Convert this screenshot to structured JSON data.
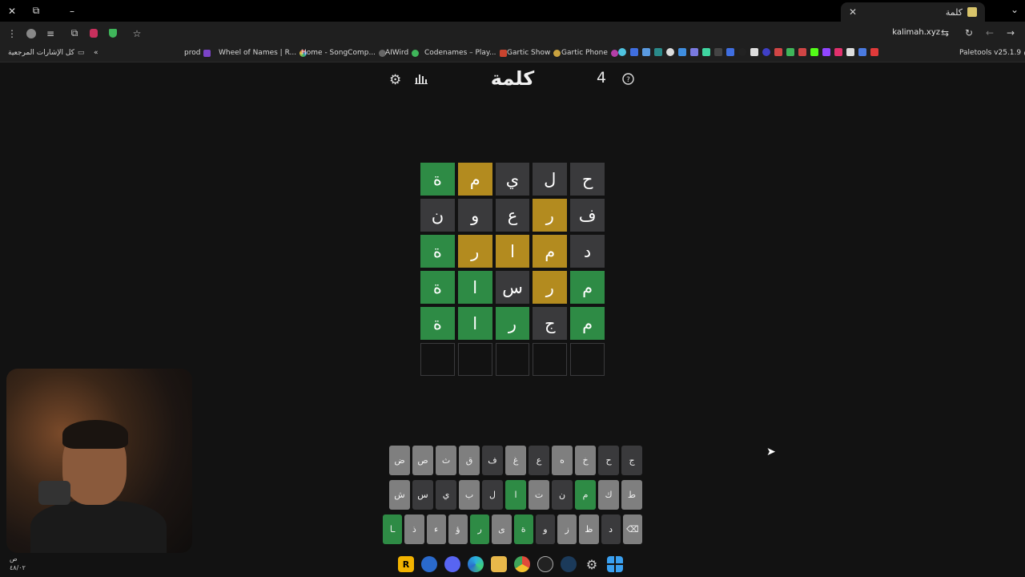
{
  "browser": {
    "tab_title": "كلمة",
    "url": "kalimah.xyz",
    "bookmarks_label": "كل الإشارات المرجعية",
    "bookmarks": [
      {
        "label": "prod",
        "color": "#7a43c6"
      },
      {
        "label": "Wheel of Names | R...",
        "color": "#e0473c"
      },
      {
        "label": "Home - SongComp...",
        "color": "#666666"
      },
      {
        "label": "AIWird",
        "color": "#3fb55a"
      },
      {
        "label": "Codenames – Play...",
        "color": "#c9442f"
      },
      {
        "label": "Gartic Show",
        "color": "#c9a23f"
      },
      {
        "label": "Gartic Phone",
        "color": "#b43fa8"
      }
    ],
    "extension_label": "Paletools v25.1.9"
  },
  "game": {
    "title": "كلمة",
    "streak": "4",
    "settings_icon": "gear-icon",
    "stats_icon": "chart-icon",
    "help_icon": "question-icon",
    "board": [
      [
        {
          "letter": "ح",
          "state": "absent"
        },
        {
          "letter": "ل",
          "state": "absent"
        },
        {
          "letter": "ي",
          "state": "absent"
        },
        {
          "letter": "م",
          "state": "present"
        },
        {
          "letter": "ة",
          "state": "correct"
        }
      ],
      [
        {
          "letter": "ف",
          "state": "absent"
        },
        {
          "letter": "ر",
          "state": "present"
        },
        {
          "letter": "ع",
          "state": "absent"
        },
        {
          "letter": "و",
          "state": "absent"
        },
        {
          "letter": "ن",
          "state": "absent"
        }
      ],
      [
        {
          "letter": "د",
          "state": "absent"
        },
        {
          "letter": "م",
          "state": "present"
        },
        {
          "letter": "ا",
          "state": "present"
        },
        {
          "letter": "ر",
          "state": "present"
        },
        {
          "letter": "ة",
          "state": "correct"
        }
      ],
      [
        {
          "letter": "م",
          "state": "correct"
        },
        {
          "letter": "ر",
          "state": "present"
        },
        {
          "letter": "س",
          "state": "absent"
        },
        {
          "letter": "ا",
          "state": "correct"
        },
        {
          "letter": "ة",
          "state": "correct"
        }
      ],
      [
        {
          "letter": "م",
          "state": "correct"
        },
        {
          "letter": "ج",
          "state": "absent"
        },
        {
          "letter": "ر",
          "state": "correct"
        },
        {
          "letter": "ا",
          "state": "correct"
        },
        {
          "letter": "ة",
          "state": "correct"
        }
      ],
      [
        {
          "letter": "",
          "state": "empty"
        },
        {
          "letter": "",
          "state": "empty"
        },
        {
          "letter": "",
          "state": "empty"
        },
        {
          "letter": "",
          "state": "empty"
        },
        {
          "letter": "",
          "state": "empty"
        }
      ]
    ],
    "keyboard": [
      [
        {
          "k": "ج",
          "s": "absent"
        },
        {
          "k": "ح",
          "s": "absent"
        },
        {
          "k": "خ",
          "s": "unused"
        },
        {
          "k": "ه",
          "s": "unused"
        },
        {
          "k": "ع",
          "s": "absent"
        },
        {
          "k": "غ",
          "s": "unused"
        },
        {
          "k": "ف",
          "s": "absent"
        },
        {
          "k": "ق",
          "s": "unused"
        },
        {
          "k": "ث",
          "s": "unused"
        },
        {
          "k": "ص",
          "s": "unused"
        },
        {
          "k": "ض",
          "s": "unused"
        }
      ],
      [
        {
          "k": "ط",
          "s": "unused"
        },
        {
          "k": "ك",
          "s": "unused"
        },
        {
          "k": "م",
          "s": "correct"
        },
        {
          "k": "ن",
          "s": "absent"
        },
        {
          "k": "ت",
          "s": "unused"
        },
        {
          "k": "ا",
          "s": "correct"
        },
        {
          "k": "ل",
          "s": "absent"
        },
        {
          "k": "ب",
          "s": "unused"
        },
        {
          "k": "ي",
          "s": "absent"
        },
        {
          "k": "س",
          "s": "absent"
        },
        {
          "k": "ش",
          "s": "unused"
        }
      ],
      [
        {
          "k": "⌫",
          "s": "unused"
        },
        {
          "k": "د",
          "s": "absent"
        },
        {
          "k": "ظ",
          "s": "unused"
        },
        {
          "k": "ز",
          "s": "unused"
        },
        {
          "k": "و",
          "s": "absent"
        },
        {
          "k": "ة",
          "s": "correct"
        },
        {
          "k": "ى",
          "s": "unused"
        },
        {
          "k": "ر",
          "s": "correct"
        },
        {
          "k": "ؤ",
          "s": "unused"
        },
        {
          "k": "ء",
          "s": "unused"
        },
        {
          "k": "ذ",
          "s": "unused"
        },
        {
          "k": "ـا",
          "s": "correct"
        }
      ]
    ]
  },
  "taskbar": {
    "time_line1": "ص",
    "time_line2": "٤٨/٠٢",
    "apps": [
      "rockstar-icon",
      "steam-link-icon",
      "discord-icon",
      "edge-icon",
      "folder-icon",
      "chrome-icon",
      "github-icon",
      "steam-icon",
      "settings-icon",
      "windows-icon"
    ]
  },
  "colors": {
    "correct": "#2e8b45",
    "present": "#b38b1f",
    "absent": "#3a3a3c"
  }
}
